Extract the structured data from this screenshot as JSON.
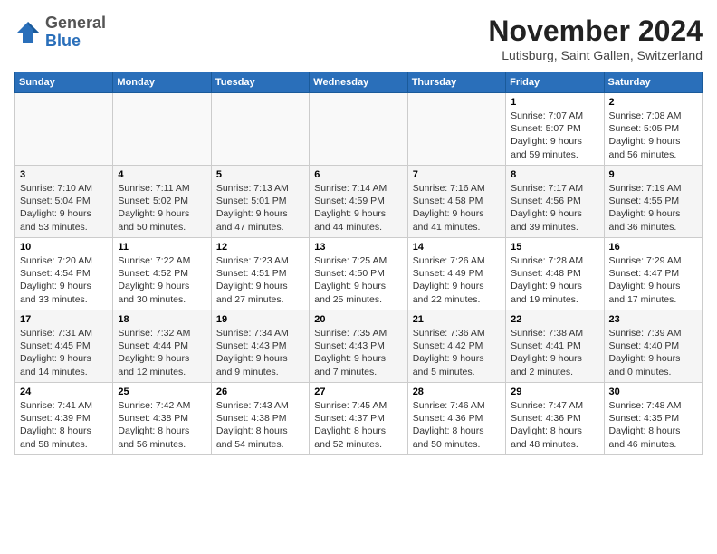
{
  "header": {
    "logo_general": "General",
    "logo_blue": "Blue",
    "main_title": "November 2024",
    "subtitle": "Lutisburg, Saint Gallen, Switzerland"
  },
  "weekdays": [
    "Sunday",
    "Monday",
    "Tuesday",
    "Wednesday",
    "Thursday",
    "Friday",
    "Saturday"
  ],
  "weeks": [
    [
      {
        "day": "",
        "info": ""
      },
      {
        "day": "",
        "info": ""
      },
      {
        "day": "",
        "info": ""
      },
      {
        "day": "",
        "info": ""
      },
      {
        "day": "",
        "info": ""
      },
      {
        "day": "1",
        "info": "Sunrise: 7:07 AM\nSunset: 5:07 PM\nDaylight: 9 hours and 59 minutes."
      },
      {
        "day": "2",
        "info": "Sunrise: 7:08 AM\nSunset: 5:05 PM\nDaylight: 9 hours and 56 minutes."
      }
    ],
    [
      {
        "day": "3",
        "info": "Sunrise: 7:10 AM\nSunset: 5:04 PM\nDaylight: 9 hours and 53 minutes."
      },
      {
        "day": "4",
        "info": "Sunrise: 7:11 AM\nSunset: 5:02 PM\nDaylight: 9 hours and 50 minutes."
      },
      {
        "day": "5",
        "info": "Sunrise: 7:13 AM\nSunset: 5:01 PM\nDaylight: 9 hours and 47 minutes."
      },
      {
        "day": "6",
        "info": "Sunrise: 7:14 AM\nSunset: 4:59 PM\nDaylight: 9 hours and 44 minutes."
      },
      {
        "day": "7",
        "info": "Sunrise: 7:16 AM\nSunset: 4:58 PM\nDaylight: 9 hours and 41 minutes."
      },
      {
        "day": "8",
        "info": "Sunrise: 7:17 AM\nSunset: 4:56 PM\nDaylight: 9 hours and 39 minutes."
      },
      {
        "day": "9",
        "info": "Sunrise: 7:19 AM\nSunset: 4:55 PM\nDaylight: 9 hours and 36 minutes."
      }
    ],
    [
      {
        "day": "10",
        "info": "Sunrise: 7:20 AM\nSunset: 4:54 PM\nDaylight: 9 hours and 33 minutes."
      },
      {
        "day": "11",
        "info": "Sunrise: 7:22 AM\nSunset: 4:52 PM\nDaylight: 9 hours and 30 minutes."
      },
      {
        "day": "12",
        "info": "Sunrise: 7:23 AM\nSunset: 4:51 PM\nDaylight: 9 hours and 27 minutes."
      },
      {
        "day": "13",
        "info": "Sunrise: 7:25 AM\nSunset: 4:50 PM\nDaylight: 9 hours and 25 minutes."
      },
      {
        "day": "14",
        "info": "Sunrise: 7:26 AM\nSunset: 4:49 PM\nDaylight: 9 hours and 22 minutes."
      },
      {
        "day": "15",
        "info": "Sunrise: 7:28 AM\nSunset: 4:48 PM\nDaylight: 9 hours and 19 minutes."
      },
      {
        "day": "16",
        "info": "Sunrise: 7:29 AM\nSunset: 4:47 PM\nDaylight: 9 hours and 17 minutes."
      }
    ],
    [
      {
        "day": "17",
        "info": "Sunrise: 7:31 AM\nSunset: 4:45 PM\nDaylight: 9 hours and 14 minutes."
      },
      {
        "day": "18",
        "info": "Sunrise: 7:32 AM\nSunset: 4:44 PM\nDaylight: 9 hours and 12 minutes."
      },
      {
        "day": "19",
        "info": "Sunrise: 7:34 AM\nSunset: 4:43 PM\nDaylight: 9 hours and 9 minutes."
      },
      {
        "day": "20",
        "info": "Sunrise: 7:35 AM\nSunset: 4:43 PM\nDaylight: 9 hours and 7 minutes."
      },
      {
        "day": "21",
        "info": "Sunrise: 7:36 AM\nSunset: 4:42 PM\nDaylight: 9 hours and 5 minutes."
      },
      {
        "day": "22",
        "info": "Sunrise: 7:38 AM\nSunset: 4:41 PM\nDaylight: 9 hours and 2 minutes."
      },
      {
        "day": "23",
        "info": "Sunrise: 7:39 AM\nSunset: 4:40 PM\nDaylight: 9 hours and 0 minutes."
      }
    ],
    [
      {
        "day": "24",
        "info": "Sunrise: 7:41 AM\nSunset: 4:39 PM\nDaylight: 8 hours and 58 minutes."
      },
      {
        "day": "25",
        "info": "Sunrise: 7:42 AM\nSunset: 4:38 PM\nDaylight: 8 hours and 56 minutes."
      },
      {
        "day": "26",
        "info": "Sunrise: 7:43 AM\nSunset: 4:38 PM\nDaylight: 8 hours and 54 minutes."
      },
      {
        "day": "27",
        "info": "Sunrise: 7:45 AM\nSunset: 4:37 PM\nDaylight: 8 hours and 52 minutes."
      },
      {
        "day": "28",
        "info": "Sunrise: 7:46 AM\nSunset: 4:36 PM\nDaylight: 8 hours and 50 minutes."
      },
      {
        "day": "29",
        "info": "Sunrise: 7:47 AM\nSunset: 4:36 PM\nDaylight: 8 hours and 48 minutes."
      },
      {
        "day": "30",
        "info": "Sunrise: 7:48 AM\nSunset: 4:35 PM\nDaylight: 8 hours and 46 minutes."
      }
    ]
  ]
}
